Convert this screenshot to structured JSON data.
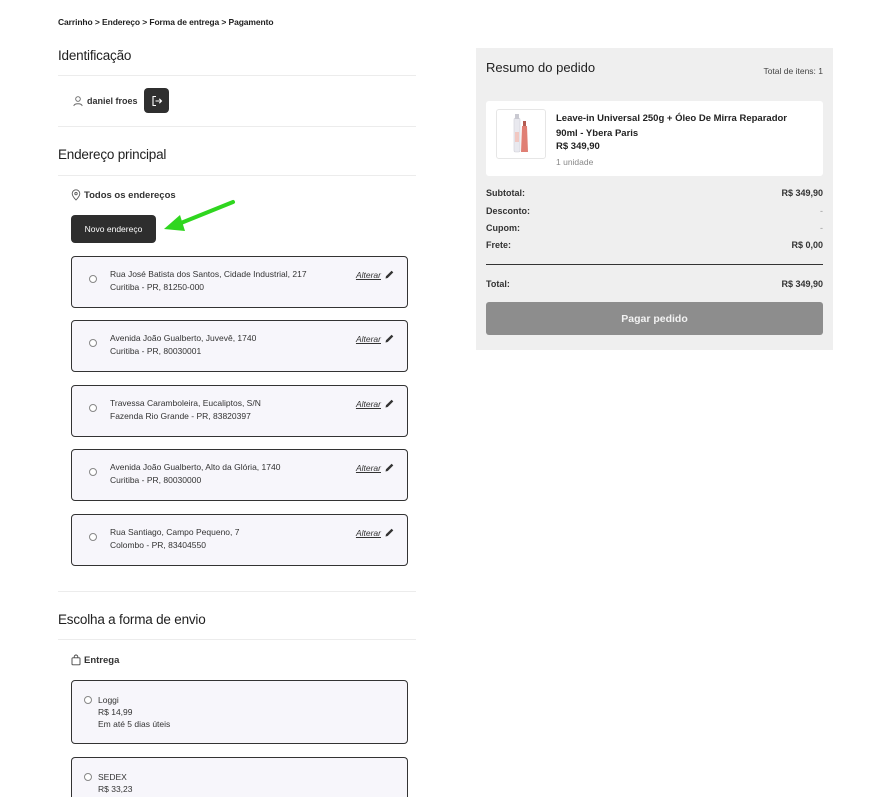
{
  "breadcrumb": {
    "items": [
      "Carrinho",
      "Endereço",
      "Forma de entrega",
      "Pagamento"
    ],
    "separator": ">"
  },
  "identification": {
    "title": "Identificação",
    "user_name": "daniel froes",
    "user_icon": "user-icon",
    "logout_icon": "logout-icon"
  },
  "address": {
    "title": "Endereço principal",
    "all_addresses_label": "Todos os endereços",
    "new_address_label": "Novo endereço",
    "edit_label": "Alterar",
    "items": [
      {
        "line1": "Rua José Batista dos Santos, Cidade Industrial, 217",
        "line2": "Curitiba - PR, 81250-000"
      },
      {
        "line1": "Avenida João Gualberto, Juvevê, 1740",
        "line2": "Curitiba - PR, 80030001"
      },
      {
        "line1": "Travessa Caramboleira, Eucaliptos, S/N",
        "line2": "Fazenda Rio Grande - PR, 83820397"
      },
      {
        "line1": "Avenida João Gualberto, Alto da Glória, 1740",
        "line2": "Curitiba - PR, 80030000"
      },
      {
        "line1": "Rua Santiago, Campo Pequeno, 7",
        "line2": "Colombo - PR, 83404550"
      }
    ]
  },
  "shipping": {
    "title": "Escolha a forma de envio",
    "subtitle": "Entrega",
    "options": [
      {
        "name": "Loggi",
        "price": "R$ 14,99",
        "eta": "Em até 5 dias úteis"
      },
      {
        "name": "SEDEX",
        "price": "R$ 33,23",
        "eta": ""
      }
    ]
  },
  "summary": {
    "title": "Resumo do pedido",
    "total_items": "Total de itens: 1",
    "product": {
      "name": "Leave-in Universal 250g + Óleo De Mirra Reparador 90ml - Ybera Paris",
      "price": "R$ 349,90",
      "quantity": "1 unidade"
    },
    "rows": {
      "subtotal_label": "Subtotal:",
      "subtotal_value": "R$ 349,90",
      "discount_label": "Desconto:",
      "discount_value": "-",
      "coupon_label": "Cupom:",
      "coupon_value": "-",
      "shipping_label": "Frete:",
      "shipping_value": "R$ 0,00",
      "total_label": "Total:",
      "total_value": "R$ 349,90"
    },
    "pay_button": "Pagar pedido"
  },
  "colors": {
    "dark_button": "#2e2e2e",
    "card_bg": "#f7f6fb",
    "summary_bg": "#efefef",
    "pay_button": "#8d8d8d",
    "arrow": "#2fd61f"
  }
}
